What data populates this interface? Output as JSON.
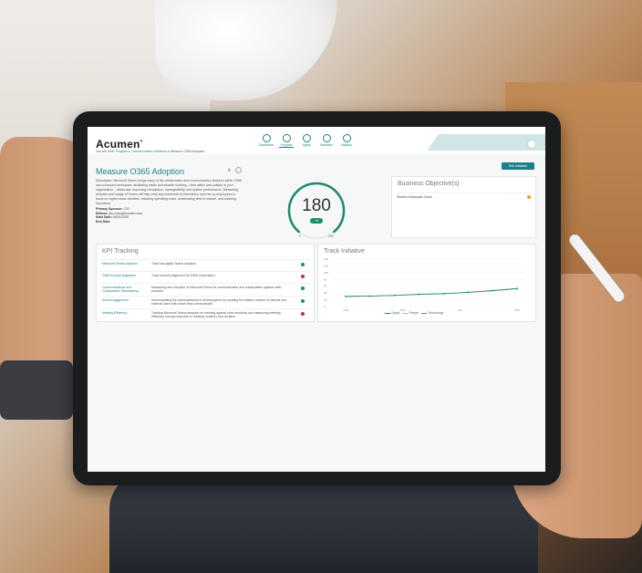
{
  "app": {
    "logo": "Acumen",
    "breadcrumb": [
      "You are here:",
      "Program",
      "Transformation Initiatives",
      "Measure O365 Adoption"
    ],
    "nav": [
      {
        "label": "Dashboard",
        "icon": "dashboard-icon"
      },
      {
        "label": "Program",
        "icon": "program-icon"
      },
      {
        "label": "Agility",
        "icon": "agility-icon"
      },
      {
        "label": "Workflow",
        "icon": "workflow-icon"
      },
      {
        "label": "Maturity",
        "icon": "maturity-icon"
      }
    ],
    "active_nav": "Program"
  },
  "initiative": {
    "title": "Measure O365 Adoption",
    "edit_label": "Edit Initiative",
    "description": "Description: Microsoft Teams brings many of the collaboration and communication features within O365 into a focused workspace, facilitating faster and smarter working – both within and outside of your organization – whilst also improving compliance, manageability, and system performance. Measuring adoption and usage of Teams will help unify improvements to information and free up employees to focus on higher-value activities, reducing operating costs, accelerating time to market, and fostering innovation.",
    "meta": [
      {
        "label": "Primary Sponsor:",
        "value": "CIO"
      },
      {
        "label": "Editors:",
        "value": "jim.romo@acumen.com"
      },
      {
        "label": "Start Date:",
        "value": "04/01/2020"
      },
      {
        "label": "End Date:",
        "value": ""
      }
    ]
  },
  "score": {
    "value": "180",
    "delta": "+0",
    "min": "0",
    "max": "180",
    "fraction": 1.0
  },
  "business_objectives": {
    "title": "Business Objective(s)",
    "items": [
      {
        "label": "Reduce Employee Churn",
        "status_color": "#f0a21a"
      }
    ]
  },
  "kpi": {
    "title": "KPI Tracking",
    "rows": [
      {
        "name": "Microsoft Teams Adoption",
        "desc": "Track low-agility Teams adoption",
        "status_color": "#1e8a6e"
      },
      {
        "name": "O365 Account Alignment",
        "desc": "Track account alignment for O365 subscription",
        "status_color": "#d6263a"
      },
      {
        "name": "Communications and Collaboration Streamlining",
        "desc": "Measuring user adoption of Microsoft Teams for communication and collaboration against other products",
        "status_color": "#1e8a6e"
      },
      {
        "name": "Email Engagement",
        "desc": "Demonstrating the connectedness of all employees by counting the fraction number of internal and external users with whom they communicate",
        "status_color": "#1e8a6e"
      },
      {
        "name": "Meeting Efficiency",
        "desc": "Tracking Microsoft Teams adoption for meeting against other solutions and measuring meeting efficiency through reduction in meeting numbers and duration",
        "status_color": "#d6263a"
      }
    ]
  },
  "chart_data": {
    "type": "line",
    "title": "Track Initiative",
    "x": [
      "7/20",
      "7/24",
      "8/1",
      "8/20"
    ],
    "ylim": [
      0,
      140
    ],
    "yticks": [
      "140",
      "120",
      "100",
      "80",
      "60",
      "40",
      "20",
      "0"
    ],
    "series": [
      {
        "name": "Digital",
        "color": "#1e8a6e",
        "values": [
          30,
          31,
          33,
          36,
          38,
          42,
          47,
          53
        ]
      },
      {
        "name": "People",
        "color": "#9fb7c9",
        "values": [
          30,
          31,
          33,
          36,
          38,
          42,
          47,
          53
        ]
      },
      {
        "name": "Technology",
        "color": "#6a7f93",
        "values": [
          30,
          31,
          33,
          36,
          38,
          42,
          47,
          53
        ]
      }
    ],
    "point_x": [
      0,
      1,
      2,
      3,
      4,
      5,
      6,
      7
    ]
  }
}
